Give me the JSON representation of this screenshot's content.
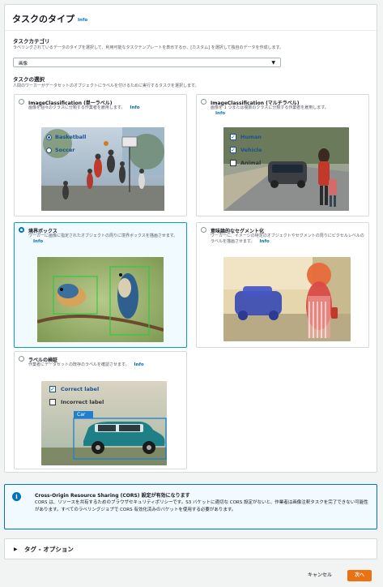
{
  "section": {
    "title": "タスクのタイプ",
    "info": "Info"
  },
  "category": {
    "label": "タスクカテゴリ",
    "description": "ラベリングされているデータのタイプを選択して、利用可能なタスクテンプレートを表示するか、[カスタム] を選択して独自のデータを作成します。",
    "selected": "画像"
  },
  "task_select": {
    "label": "タスクの選択",
    "description": "人間のワーカーがデータセットのオブジェクトにラベルを付けるために実行するタスクを選択します。"
  },
  "tiles": [
    {
      "title": "ImageClassification (単一ラベル)",
      "description": "画像を個々のクラスに分類する作業者を雇用します。",
      "info": "Info",
      "selected": false,
      "image_labels": [
        "Basketball",
        "Soccer"
      ]
    },
    {
      "title": "ImageClassification (マルチラベル)",
      "description": "画像を 1 つまたは複数のクラスに分類する作業者を雇用します。",
      "info": "Info",
      "selected": false,
      "image_labels": [
        "Human",
        "Vehicle",
        "Animal"
      ]
    },
    {
      "title": "境界ボックス",
      "description": "ワーカーに画像に指定されたオブジェクトの周りに境界ボックスを描画させます。",
      "info": "Info",
      "selected": true
    },
    {
      "title": "意味論的なセグメント化",
      "description": "ワーカーに、イメージの特定のオブジェクトやセグメントの周りにピクセルレベルのラベルを描画させます。",
      "info": "Info",
      "selected": false
    },
    {
      "title": "ラベルの検証",
      "description": "作業者にデータセットの既存のラベルを確認させます。",
      "info": "Info",
      "selected": false,
      "image_labels": [
        "Correct label",
        "Incorrect label",
        "Car"
      ]
    }
  ],
  "alert": {
    "title": "Cross-Origin Resource Sharing (CORS) 設定が有効になります",
    "body": "CORS は、リソースを共有するためのブラウザセキュリティポリシーです。S3 バケットに適切な CORS 設定がないと、作業者は画像注釈タスクを完了できない可能性があります。すべてのラベリングジョブで CORS 有効化済みのバケットを使用する必要があります。",
    "icon": "info-circle-icon"
  },
  "tags_section": {
    "label": "タグ - オプション"
  },
  "footer": {
    "cancel": "キャンセル",
    "next": "次へ"
  },
  "colors": {
    "primary": "#ec7211",
    "link": "#0073bb",
    "selected_border": "#00a1c9"
  }
}
